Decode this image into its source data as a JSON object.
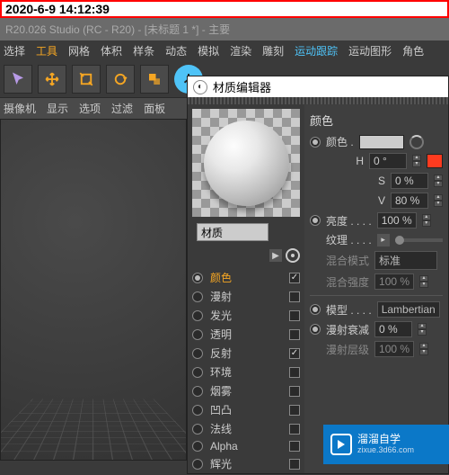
{
  "timestamp": "2020-6-9 14:12:39",
  "app": {
    "title": "R20.026 Studio (RC - R20) - [未标题 1 *] - 主要"
  },
  "menu": {
    "select": "选择",
    "tools": "工具",
    "mesh": "网格",
    "volume": "体积",
    "spline": "样条",
    "motion": "动态",
    "sim": "模拟",
    "render": "渲染",
    "sculpt": "雕刻",
    "motrack": "运动跟踪",
    "mograph": "运动图形",
    "char": "角色"
  },
  "secondary": {
    "cam": "摄像机",
    "disp": "显示",
    "opt": "选项",
    "filter": "过滤",
    "panel": "面板"
  },
  "material_editor": {
    "title": "材质编辑器",
    "name_value": "材质",
    "channels": [
      {
        "label": "颜色",
        "checked": true,
        "active": true
      },
      {
        "label": "漫射",
        "checked": false
      },
      {
        "label": "发光",
        "checked": false
      },
      {
        "label": "透明",
        "checked": false
      },
      {
        "label": "反射",
        "checked": true
      },
      {
        "label": "环境",
        "checked": false
      },
      {
        "label": "烟雾",
        "checked": false
      },
      {
        "label": "凹凸",
        "checked": false
      },
      {
        "label": "法线",
        "checked": false
      },
      {
        "label": "Alpha",
        "checked": false
      },
      {
        "label": "辉光",
        "checked": false
      }
    ],
    "right": {
      "section": "颜色",
      "color_label": "颜色 .",
      "h_label": "H",
      "h_value": "0 °",
      "s_label": "S",
      "s_value": "0 %",
      "v_label": "V",
      "v_value": "80 %",
      "brightness_label": "亮度 . . . .",
      "brightness_value": "100 %",
      "texture_label": "纹理 . . . .",
      "blend_mode_label": "混合模式",
      "blend_mode_value": "标准",
      "blend_strength_label": "混合强度",
      "blend_strength_value": "100 %",
      "model_label": "模型 . . . .",
      "model_value": "Lambertian",
      "diff_falloff_label": "漫射衰减",
      "diff_falloff_value": "0 %",
      "diff_level_label": "漫射层级",
      "diff_level_value": "100 %"
    }
  },
  "watermark": {
    "brand": "溜溜自学",
    "url": "zixue.3d66.com"
  }
}
